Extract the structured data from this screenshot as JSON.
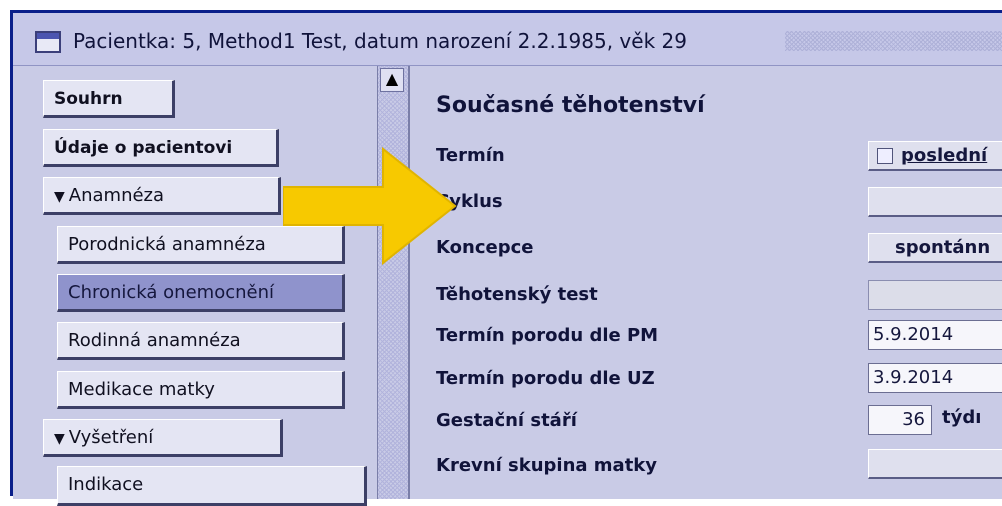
{
  "window": {
    "title": "Pacientka: 5, Method1 Test, datum narození 2.2.1985, věk 29"
  },
  "sidebar": {
    "items": [
      {
        "label": "Souhrn"
      },
      {
        "label": "Údaje o pacientovi"
      },
      {
        "label": "Anamnéza"
      },
      {
        "label": "Porodnická anamnéza"
      },
      {
        "label": "Chronická onemocnění"
      },
      {
        "label": "Rodinná anamnéza"
      },
      {
        "label": "Medikace matky"
      },
      {
        "label": "Vyšetření"
      },
      {
        "label": "Indikace"
      }
    ],
    "selected": "Chronická onemocnění"
  },
  "main": {
    "section_title": "Současné těhotenství",
    "rows": [
      {
        "label": "Termín",
        "value": "poslední"
      },
      {
        "label": "Cyklus",
        "value": ""
      },
      {
        "label": "Koncepce",
        "value": "spontánn"
      },
      {
        "label": "Těhotenský test",
        "value": ""
      },
      {
        "label": "Termín porodu dle PM",
        "value": "5.9.2014"
      },
      {
        "label": "Termín porodu dle UZ",
        "value": "3.9.2014"
      },
      {
        "label": "Gestační stáří",
        "value": "36",
        "unit": "týdı"
      },
      {
        "label": "Krevní skupina matky",
        "value": ""
      }
    ]
  },
  "colors": {
    "background": "#c9cbe6",
    "window_border": "#0a1f8a",
    "selected_item": "#8f93cc",
    "annotation_arrow": "#f7c900"
  },
  "icons": {
    "window": "window-icon",
    "expand": "triangle-down-icon",
    "scroll_up": "scroll-up-arrow-icon",
    "annotation": "yellow-arrow-annotation"
  }
}
